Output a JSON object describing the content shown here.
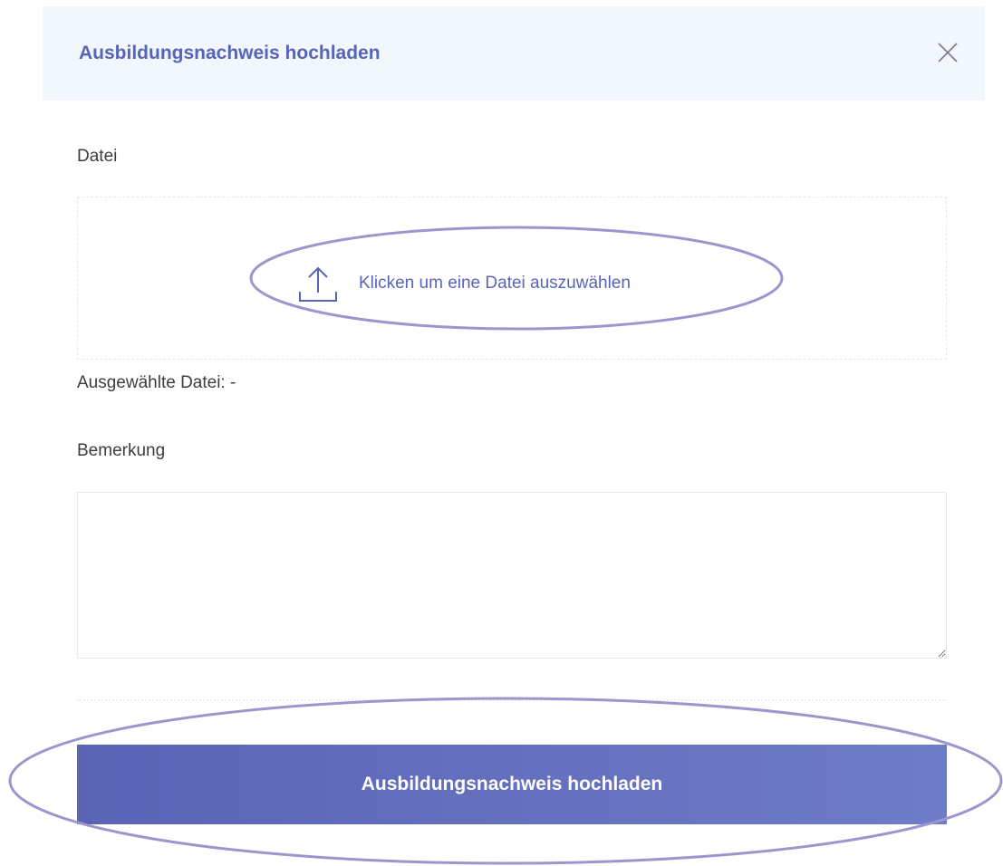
{
  "modal": {
    "title": "Ausbildungsnachweis hochladen",
    "close_icon": "close-icon"
  },
  "file": {
    "label": "Datei",
    "dropzone_text": "Klicken um eine Datei auszuwählen",
    "upload_icon": "upload-icon",
    "selected_label": "Ausgewählte Datei:",
    "selected_value": "-"
  },
  "remark": {
    "label": "Bemerkung",
    "value": ""
  },
  "submit": {
    "label": "Ausbildungsnachweis hochladen"
  },
  "colors": {
    "accent": "#5864b8",
    "header_bg": "#f1f7fd",
    "button_gradient_start": "#5b63b6",
    "button_gradient_end": "#6e7cc6",
    "annotation": "#9b97cc"
  }
}
